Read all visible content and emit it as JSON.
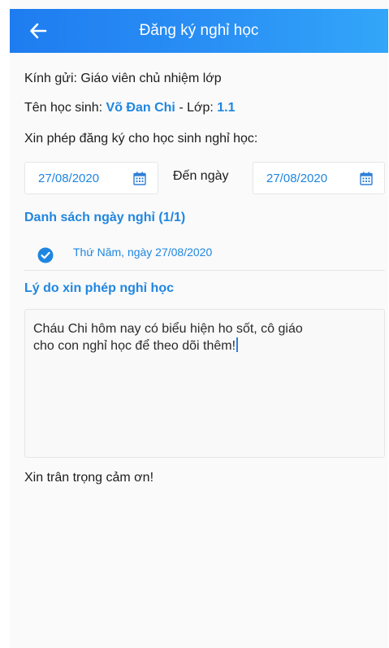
{
  "header": {
    "title": "Đăng ký nghỉ học"
  },
  "form": {
    "kinh_gui_label": "Kính gửi:",
    "kinh_gui_value": "Giáo viên chủ nhiệm lớp",
    "student_label": "Tên học sinh:",
    "student_name": "Võ Đan Chi",
    "separator": "-",
    "class_label": "Lớp:",
    "class_value": "1.1",
    "request_text": "Xin phép đăng ký cho học sinh nghỉ học:",
    "from_date": "27/08/2020",
    "to_label": "Đến ngày",
    "to_date": "27/08/2020",
    "days_list_title": "Danh sách ngày nghỉ (1/1)",
    "days": [
      {
        "label": "Thứ Năm, ngày 27/08/2020",
        "checked": true
      }
    ],
    "reason_title": "Lý do xin phép nghỉ học",
    "reason_line1": "Cháu Chi hôm nay có biểu hiện ho sốt, cô giáo",
    "reason_line2": "cho con nghỉ học để theo dõi thêm!",
    "closing": "Xin trân trọng cảm ơn!"
  },
  "colors": {
    "accent": "#1f86e0",
    "header_start": "#1e7cf0",
    "header_end": "#32a6f9"
  },
  "icons": {
    "back": "arrow-left-icon",
    "calendar": "calendar-icon",
    "check": "check-circle-icon"
  }
}
